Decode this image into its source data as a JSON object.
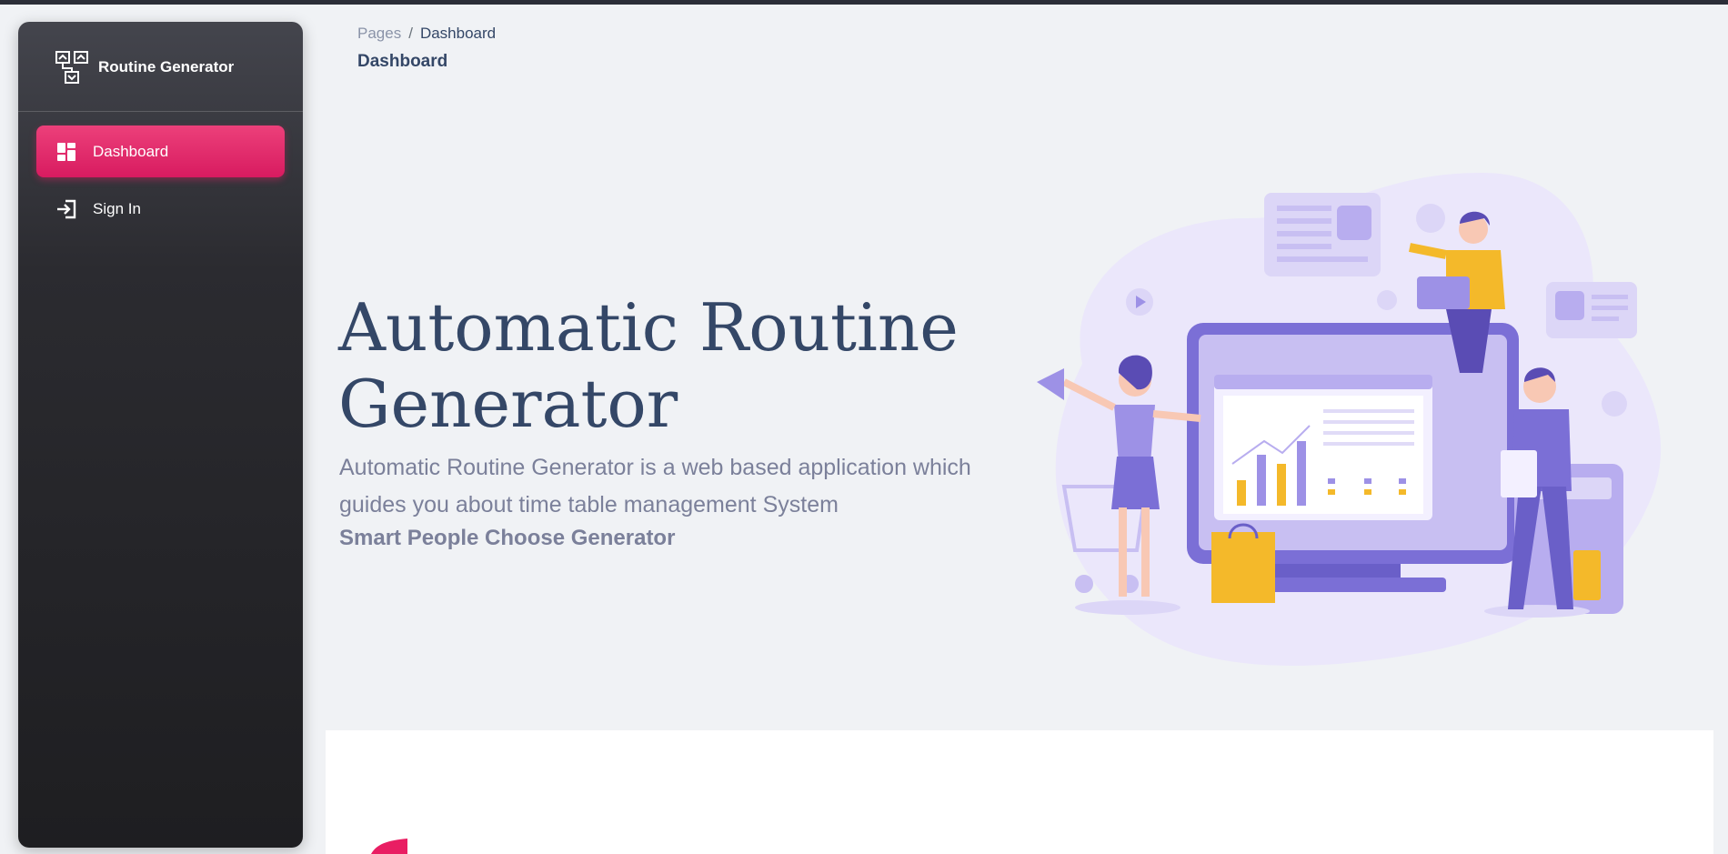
{
  "app": {
    "brand": "Routine Generator"
  },
  "sidebar": {
    "items": [
      {
        "label": "Dashboard",
        "icon": "dashboard-icon",
        "active": true
      },
      {
        "label": "Sign In",
        "icon": "login-icon",
        "active": false
      }
    ]
  },
  "breadcrumb": {
    "root": "Pages",
    "separator": "/",
    "current": "Dashboard"
  },
  "page": {
    "title": "Dashboard"
  },
  "hero": {
    "title": "Automatic Routine Generator",
    "description": "Automatic Routine Generator is a web based application which guides you about time table management System",
    "tagline": "Smart People Choose Generator"
  },
  "colors": {
    "accent": "#e91e63",
    "text_primary": "#344767",
    "text_secondary": "#7b809a",
    "illustration": "#7b6fd6"
  }
}
